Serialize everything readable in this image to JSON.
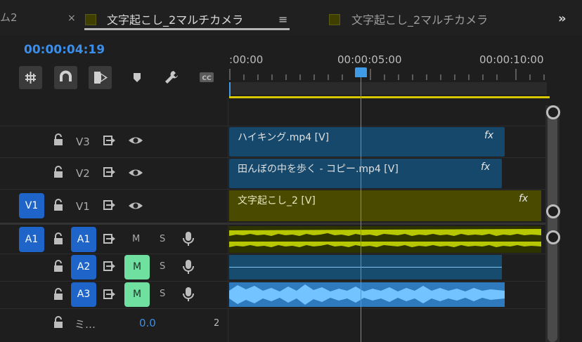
{
  "tabs": {
    "left_fragment": "ム2",
    "close": "×",
    "active_title": "文字起こし_2マルチカメラ",
    "menu": "≡",
    "inactive_title": "文字起こし_2マルチカメラ",
    "more": "»"
  },
  "timecode": "00:00:04:19",
  "ruler": {
    "labels": [
      ":00:00",
      "00:00:05:00",
      "00:00:10:00"
    ]
  },
  "tracks": {
    "V3": {
      "lock": "🔒",
      "label": "V3"
    },
    "V2": {
      "lock": "🔒",
      "label": "V2"
    },
    "V1": {
      "src": "V1",
      "label": "V1"
    },
    "A1": {
      "src": "A1",
      "label": "A1",
      "mute": "M",
      "solo": "S"
    },
    "A2": {
      "label": "A2",
      "mute": "M",
      "solo": "S"
    },
    "A3": {
      "label": "A3",
      "mute": "M",
      "solo": "S"
    },
    "master": {
      "label": "ミ…",
      "value": "0.0",
      "channels": "2"
    }
  },
  "clips": {
    "v3": {
      "name": "ハイキング.mp4 [V]",
      "fx": "fx"
    },
    "v2": {
      "name": "田んぼの中を歩く - コピー.mp4 [V]",
      "fx": "fx"
    },
    "v1": {
      "name": "文字起こし_2 [V]",
      "fx": "fx"
    }
  },
  "colors": {
    "accent": "#3b8eea",
    "active_track": "#1f64c8",
    "mute_on": "#6fe0a0",
    "video_clip": "#15486a",
    "nested_clip": "#4a4a00",
    "audio_wave": "#b7c800"
  },
  "icons": [
    "snap-icon",
    "magnet-icon",
    "linked-selection-icon",
    "marker-icon",
    "wrench-icon",
    "captions-icon",
    "lock-icon",
    "sync-icon",
    "eye-icon",
    "mic-icon"
  ]
}
